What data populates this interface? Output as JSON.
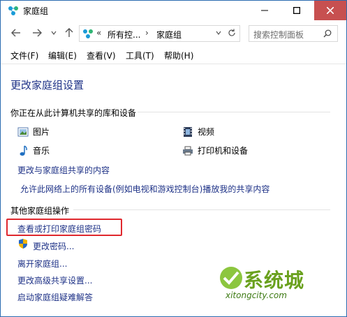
{
  "window": {
    "title": "家庭组",
    "controls": {
      "minimize_icon": "minimize-icon",
      "maximize_icon": "maximize-icon",
      "close_icon": "close-icon"
    }
  },
  "nav": {
    "back_icon": "back-arrow-icon",
    "forward_icon": "forward-arrow-icon",
    "recent_icon": "chevron-down-icon",
    "up_icon": "up-arrow-icon"
  },
  "address": {
    "overflow": "«",
    "crumbs": [
      "所有控...",
      "家庭组"
    ],
    "separator": "›"
  },
  "search": {
    "placeholder": "搜索控制面板"
  },
  "menu": [
    "文件(F)",
    "编辑(E)",
    "查看(V)",
    "工具(T)",
    "帮助(H)"
  ],
  "page": {
    "title": "更改家庭组设置",
    "share_section": "你正在从此计算机共享的库和设备",
    "libraries": [
      {
        "label": "图片",
        "icon": "pictures-icon"
      },
      {
        "label": "视频",
        "icon": "videos-icon"
      },
      {
        "label": "音乐",
        "icon": "music-icon"
      },
      {
        "label": "打印机和设备",
        "icon": "printer-icon"
      }
    ],
    "links": {
      "change_shared": "更改与家庭组共享的内容",
      "allow_devices": "允许此网络上的所有设备(例如电视和游戏控制台)播放我的共享内容"
    },
    "other_section": "其他家庭组操作",
    "actions": [
      "查看或打印家庭组密码",
      "更改密码...",
      "离开家庭组...",
      "更改高级共享设置...",
      "启动家庭组疑难解答"
    ]
  },
  "watermark": {
    "main": "系统城",
    "sub": "xitongcity.com"
  },
  "colors": {
    "link": "#1e3287",
    "highlight": "#e0282e",
    "close_button": "#c75050"
  }
}
